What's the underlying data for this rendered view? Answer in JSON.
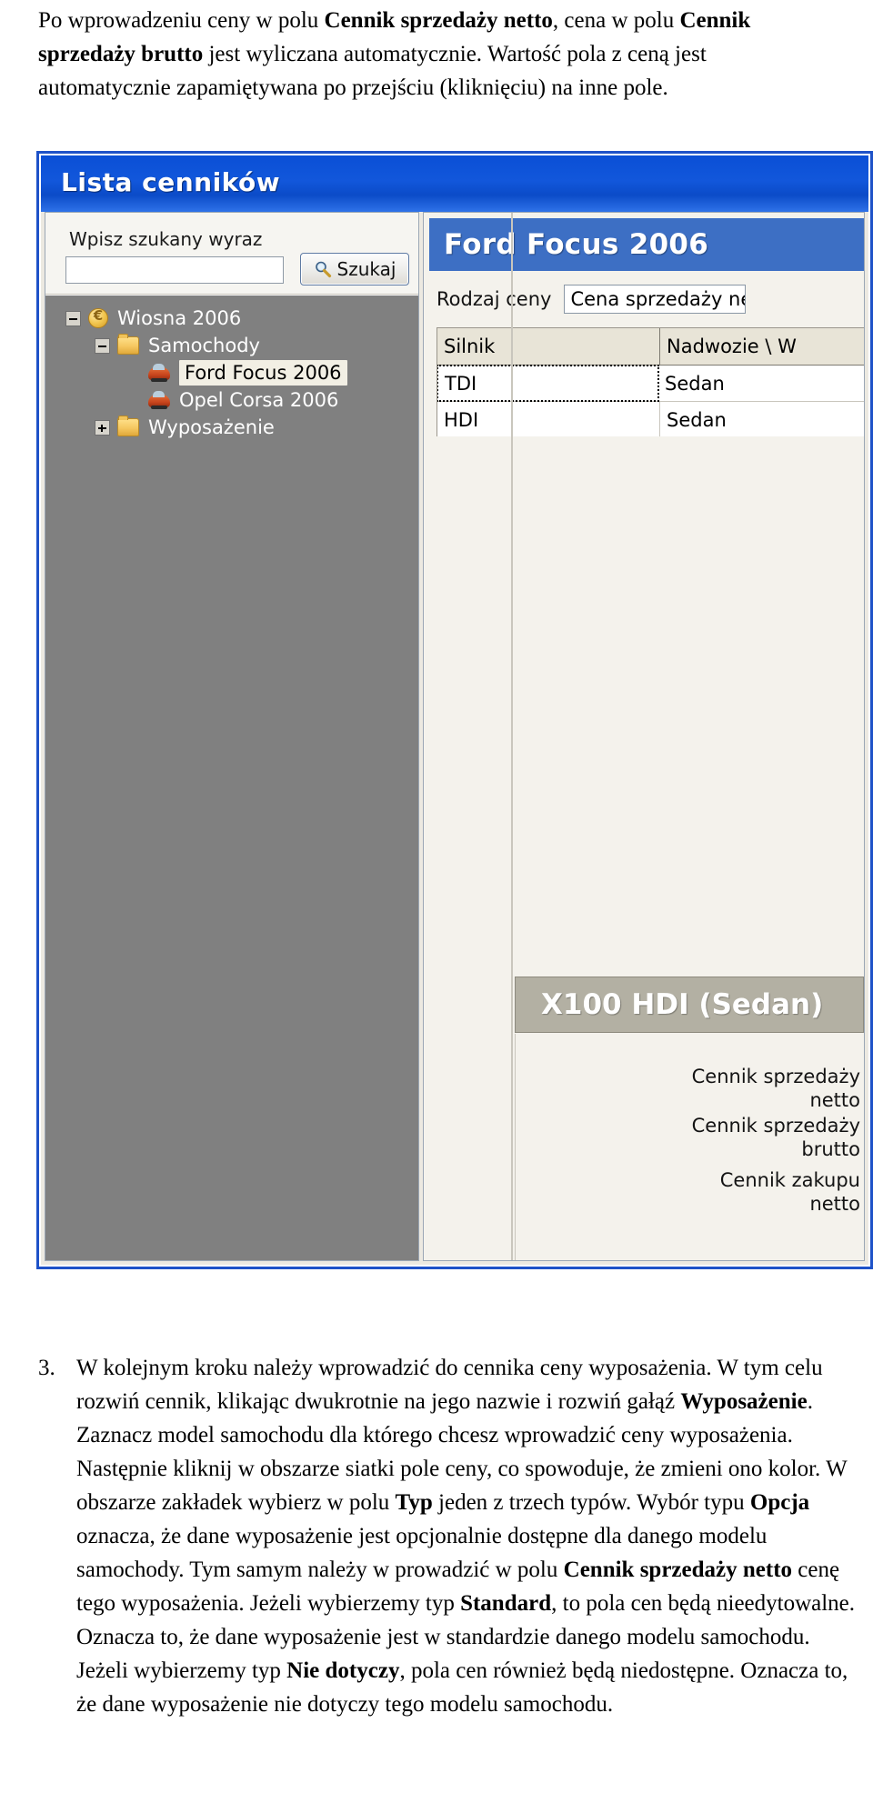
{
  "document": {
    "intro_paragraph": {
      "segments": [
        {
          "text": "Po wprowadzeniu ceny w polu ",
          "bold": false
        },
        {
          "text": "Cennik sprzedaży netto",
          "bold": true
        },
        {
          "text": ", cena w polu ",
          "bold": false
        },
        {
          "text": "Cennik sprzedaży brutto",
          "bold": true
        },
        {
          "text": " jest wyliczana automatycznie. Wartość pola z ceną jest automatycznie zapamiętywana po przejściu (kliknięciu) na inne pole.",
          "bold": false
        }
      ]
    },
    "numbered_item": {
      "marker": "3.",
      "segments": [
        {
          "text": "W kolejnym kroku należy wprowadzić do cennika ceny wyposażenia. W tym celu rozwiń cennik, klikając dwukrotnie na jego nazwie i rozwiń gałąź ",
          "bold": false
        },
        {
          "text": "Wyposażenie",
          "bold": true
        },
        {
          "text": ". Zaznacz model samochodu dla którego chcesz wprowadzić ceny wyposażenia. Następnie kliknij w obszarze siatki pole ceny, co spowoduje, że zmieni ono kolor. W obszarze zakładek wybierz w polu ",
          "bold": false
        },
        {
          "text": "Typ",
          "bold": true
        },
        {
          "text": " jeden z trzech typów. Wybór typu ",
          "bold": false
        },
        {
          "text": "Opcja",
          "bold": true
        },
        {
          "text": " oznacza, że dane wyposażenie jest opcjonalnie dostępne dla danego modelu samochody. Tym samym należy w prowadzić w polu ",
          "bold": false
        },
        {
          "text": "Cennik sprzedaży netto",
          "bold": true
        },
        {
          "text": " cenę tego wyposażenia. Jeżeli wybierzemy typ ",
          "bold": false
        },
        {
          "text": "Standard",
          "bold": true
        },
        {
          "text": ", to pola cen będą nieedytowalne. Oznacza to, że dane wyposażenie jest w standardzie danego modelu samochodu. Jeżeli wybierzemy typ ",
          "bold": false
        },
        {
          "text": "Nie dotyczy",
          "bold": true
        },
        {
          "text": ", pola cen również będą niedostępne. Oznacza to, że dane wyposażenie nie dotyczy tego modelu samochodu.",
          "bold": false
        }
      ]
    }
  },
  "screenshot": {
    "window": {
      "title": "Lista cenników",
      "title_bar_color": "#0d50d3",
      "border_color": "#1e52c8"
    },
    "left_pane": {
      "search": {
        "label": "Wpisz szukany wyraz",
        "input_value": "",
        "input_placeholder": "",
        "button_label": "Szukaj",
        "button_icon": "magnifier-icon"
      },
      "tree": {
        "background_color": "#808080",
        "nodes": [
          {
            "label": "Wiosna 2006",
            "level": 0,
            "icon": "money-icon",
            "expander": "minus",
            "selected": false
          },
          {
            "label": "Samochody",
            "level": 1,
            "icon": "folder-icon",
            "expander": "minus",
            "selected": false
          },
          {
            "label": "Ford Focus 2006",
            "level": 2,
            "icon": "car-icon",
            "expander": "none",
            "selected": true
          },
          {
            "label": "Opel Corsa 2006",
            "level": 2,
            "icon": "car-icon",
            "expander": "none",
            "selected": false
          },
          {
            "label": "Wyposażenie",
            "level": 1,
            "icon": "folder-icon",
            "expander": "plus",
            "selected": false
          }
        ]
      }
    },
    "right_pane": {
      "model_header": "Ford Focus 2006",
      "model_header_color": "#3d6fc4",
      "price_type": {
        "label": "Rodzaj ceny",
        "value": "Cena sprzedaży ne"
      },
      "grid": {
        "columns": [
          "Silnik",
          "Nadwozie \\ W"
        ],
        "rows": [
          {
            "cells": [
              "TDI",
              "Sedan"
            ],
            "current": true
          },
          {
            "cells": [
              "HDI",
              "Sedan"
            ],
            "current": false
          }
        ]
      },
      "equipment_header": "X100 HDI (Sedan)",
      "equipment_header_color": "#b3b0a3",
      "field_labels": [
        "Cennik sprzedaży\nnetto",
        "Cennik sprzedaży\nbrutto",
        "Cennik zakupu\nnetto"
      ]
    }
  }
}
